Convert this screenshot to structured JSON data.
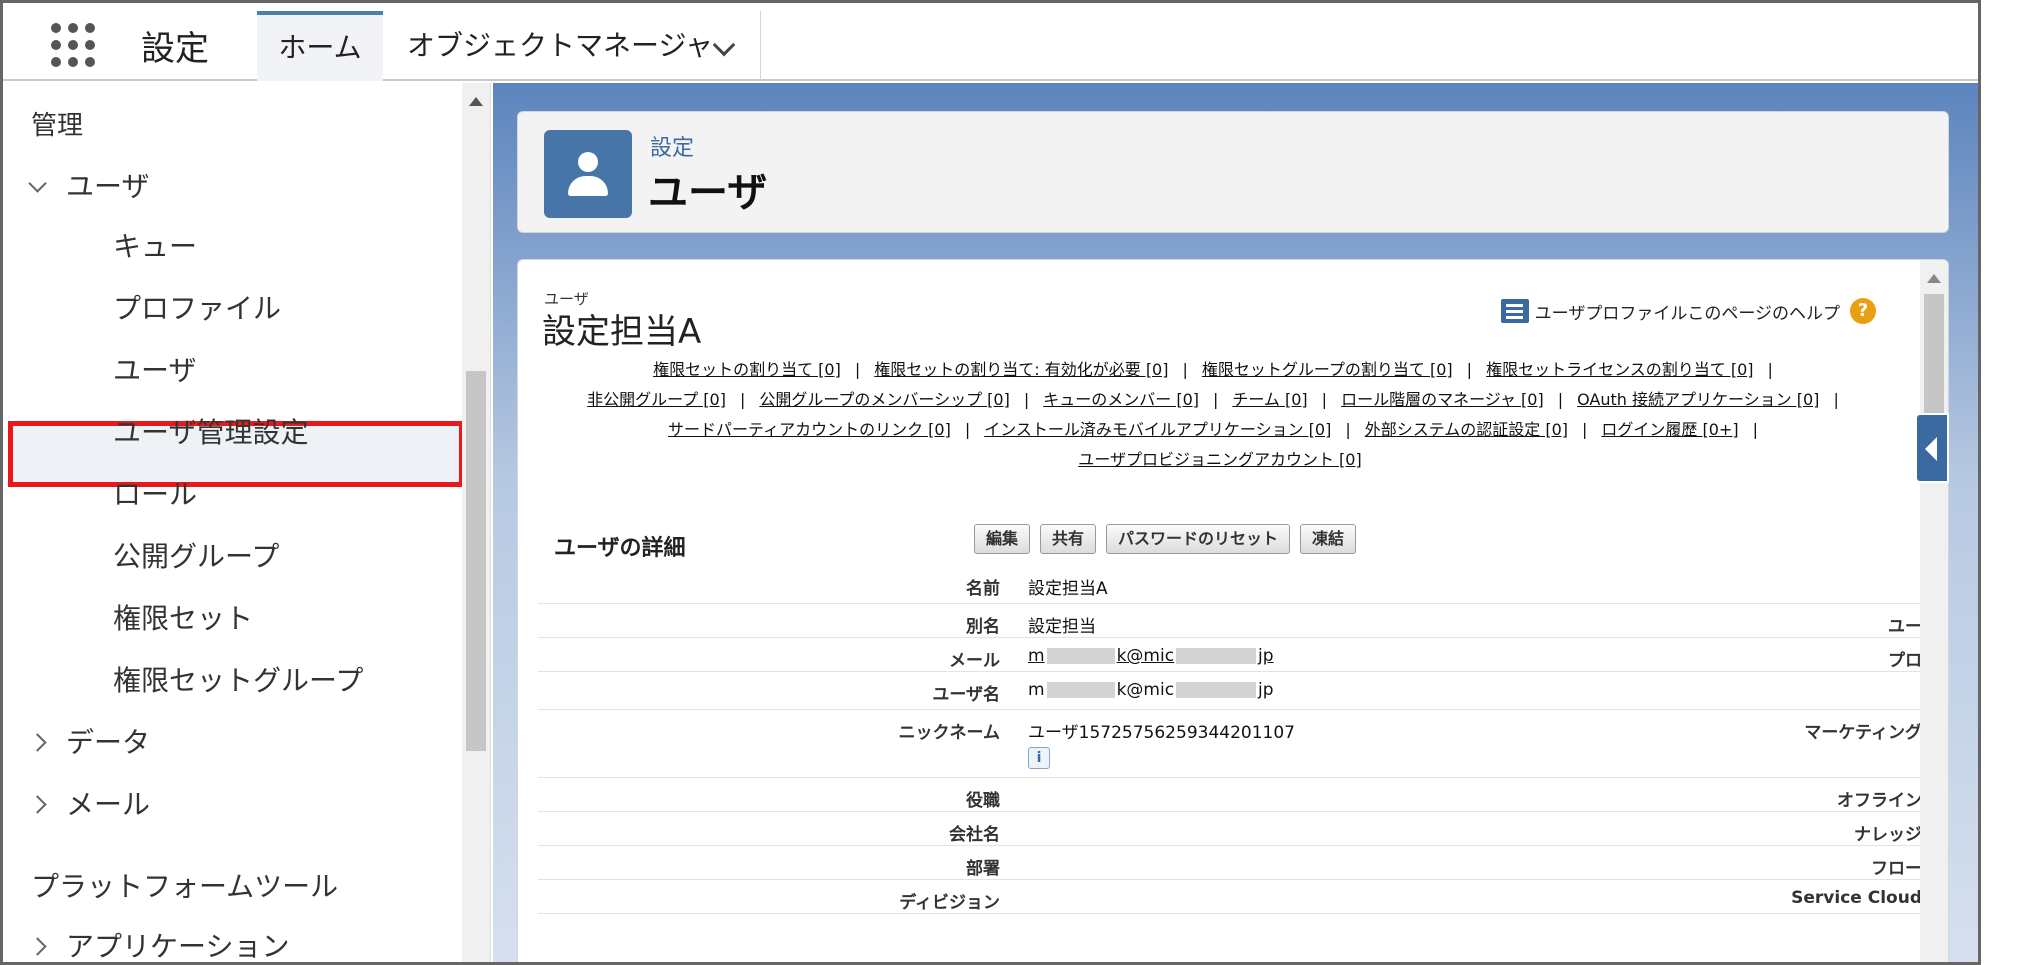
{
  "topbar": {
    "app_title": "設定",
    "tab_home": "ホーム",
    "tab_object_manager": "オブジェクトマネージャ"
  },
  "sidebar": {
    "admin_label": "管理",
    "users_group": "ユーザ",
    "users_items": [
      "キュー",
      "プロファイル",
      "ユーザ",
      "ユーザ管理設定",
      "ロール",
      "公開グループ",
      "権限セット",
      "権限セットグループ"
    ],
    "selected_item": "ユーザ",
    "data_group": "データ",
    "email_group": "メール",
    "platform_tools": "プラットフォームツール",
    "apps_group": "アプリケーション"
  },
  "header": {
    "breadcrumb": "設定",
    "title": "ユーザ"
  },
  "record": {
    "object_label": "ユーザ",
    "title": "設定担当A",
    "help_text": "ユーザプロファイルこのページのヘルプ"
  },
  "related_lists": {
    "line1": [
      "権限セットの割り当て [0]",
      "権限セットの割り当て: 有効化が必要 [0]",
      "権限セットグループの割り当て [0]",
      "権限セットライセンスの割り当て [0]"
    ],
    "line2": [
      "非公開グループ [0]",
      "公開グループのメンバーシップ [0]",
      "キューのメンバー [0]",
      "チーム [0]",
      "ロール階層のマネージャ [0]",
      "OAuth 接続アプリケーション [0]"
    ],
    "line3": [
      "サードパーティアカウントのリンク [0]",
      "インストール済みモバイルアプリケーション [0]",
      "外部システムの認証設定 [0]",
      "ログイン履歴 [0+]"
    ],
    "line4": [
      "ユーザプロビジョニングアカウント [0]"
    ]
  },
  "detail": {
    "section_title": "ユーザの詳細",
    "buttons": {
      "edit": "編集",
      "share": "共有",
      "reset_password": "パスワードのリセット",
      "freeze": "凍結"
    },
    "fields": {
      "name_label": "名前",
      "name_value": "設定担当A",
      "alias_label": "別名",
      "alias_value": "設定担当",
      "alias_right": "ユー",
      "email_label": "メール",
      "email_prefix": "m",
      "email_mid": "k@mic",
      "email_suffix": "jp",
      "email_right": "プロ",
      "username_label": "ユーザ名",
      "username_prefix": "m",
      "username_mid": "k@mic",
      "username_suffix": "jp",
      "nickname_label": "ニックネーム",
      "nickname_value": "ユーザ1572575625934420110​7",
      "nickname_right": "マーケティング",
      "info_glyph": "i",
      "title_label": "役職",
      "title_right": "オフライン",
      "company_label": "会社名",
      "company_right": "ナレッジ",
      "department_label": "部署",
      "department_right": "フロー",
      "division_label": "ディビジョン",
      "division_right": "Service Cloud"
    }
  },
  "colors": {
    "accent": "#4775a8",
    "highlight_border": "#e8191c",
    "background_blue": "#5c84bd"
  }
}
